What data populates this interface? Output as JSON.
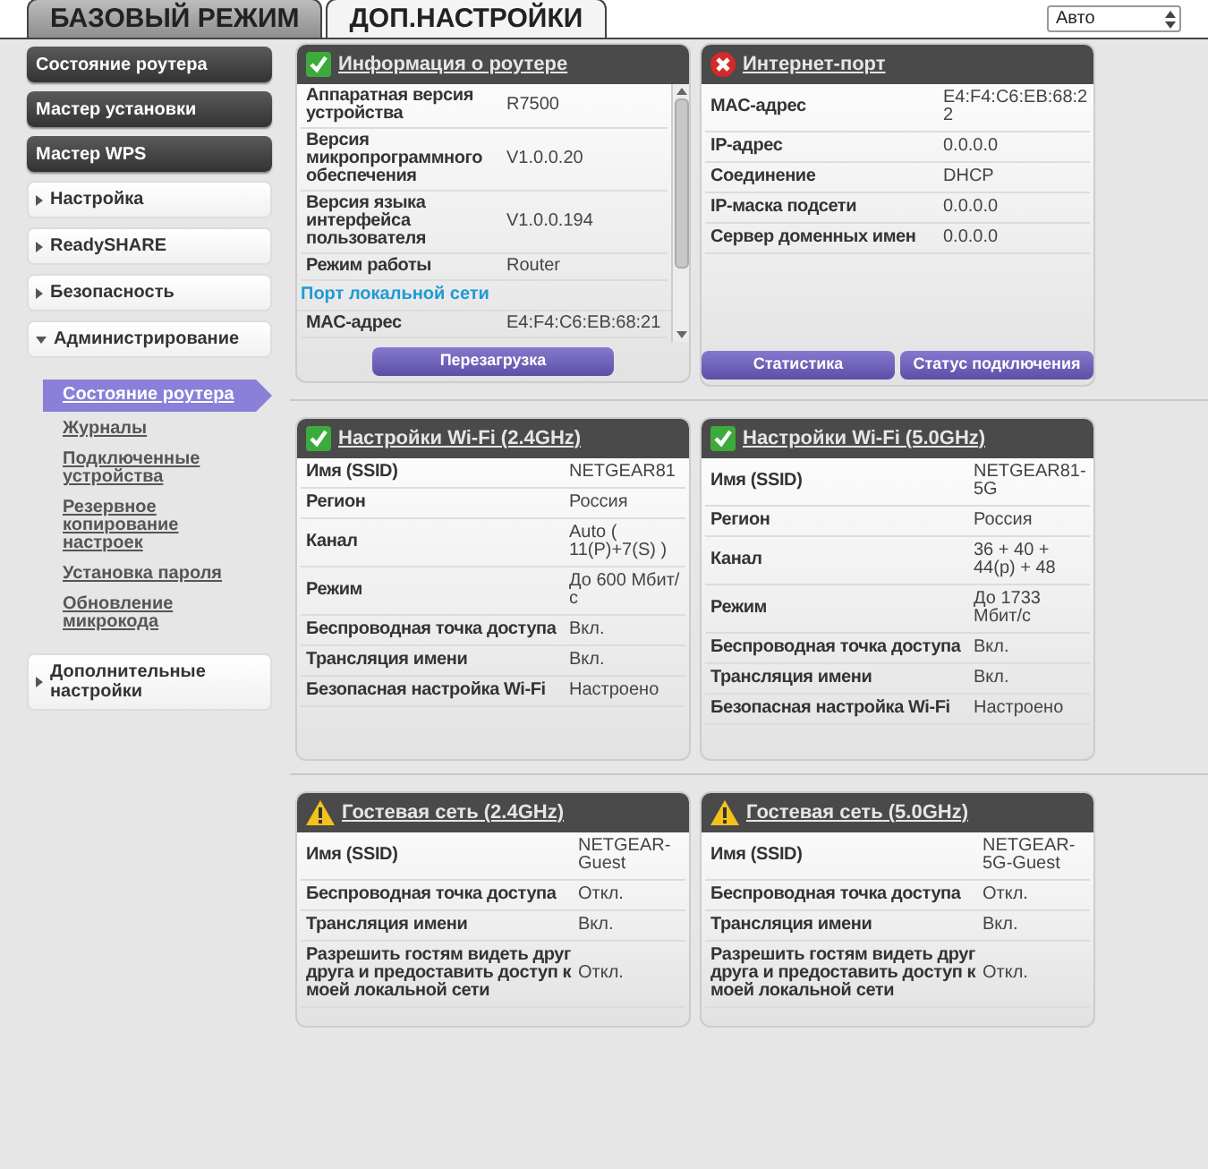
{
  "mode_tabs": [
    {
      "label": "БАЗОВЫЙ РЕЖИМ",
      "selected": false
    },
    {
      "label": "ДОП.НАСТРОЙКИ",
      "selected": true
    }
  ],
  "language_select": {
    "value": "Авто"
  },
  "sidebar": {
    "items": [
      {
        "kind": "button",
        "label": "Состояние роутера"
      },
      {
        "kind": "button",
        "label": "Мастер установки"
      },
      {
        "kind": "button",
        "label": "Мастер WPS"
      },
      {
        "kind": "section",
        "label": "Настройка",
        "expanded": false
      },
      {
        "kind": "section",
        "label": "ReadySHARE",
        "expanded": false
      },
      {
        "kind": "section",
        "label": "Безопасность",
        "expanded": false
      },
      {
        "kind": "section",
        "label": "Администрирование",
        "expanded": true,
        "children": [
          {
            "label": "Состояние роутера",
            "selected": true
          },
          {
            "label": "Журналы",
            "selected": false
          },
          {
            "label": "Подключенные устройства",
            "selected": false
          },
          {
            "label": "Резервное копирование настроек",
            "selected": false
          },
          {
            "label": "Установка пароля",
            "selected": false
          },
          {
            "label": "Обновление микрокода",
            "selected": false
          }
        ]
      },
      {
        "kind": "section",
        "label": "Дополнительные настройки",
        "expanded": false
      }
    ]
  },
  "panels": [
    {
      "title": "Информация о роутере",
      "kind": "ok",
      "scrollbar": true,
      "rows": [
        {
          "label": "Аппаратная версия устройства",
          "value": "R7500"
        },
        {
          "label": "Версия микропрограммного обеспечения",
          "value": "V1.0.0.20"
        },
        {
          "label": "Версия языка интерфейса пользователя",
          "value": "V1.0.0.194"
        },
        {
          "label": "Режим работы",
          "value": "Router"
        },
        {
          "kind": "section",
          "label": "Порт локальной сети"
        },
        {
          "label": "MAC-адрес",
          "value": "E4:F4:C6:EB:68:21"
        }
      ],
      "buttons": [
        "Перезагрузка"
      ]
    },
    {
      "title": "Интернет-порт",
      "kind": "error",
      "rows": [
        {
          "label": "MAC-адрес",
          "value": "E4:F4:C6:EB:68:22"
        },
        {
          "label": "IP-адрес",
          "value": "0.0.0.0"
        },
        {
          "label": "Соединение",
          "value": "DHCP"
        },
        {
          "label": "IP-маска подсети",
          "value": "0.0.0.0"
        },
        {
          "label": "Сервер доменных имен",
          "value": "0.0.0.0"
        }
      ],
      "buttons": [
        "Статистика",
        "Статус подключения"
      ]
    },
    {
      "title": "Настройки Wi-Fi (2.4GHz)",
      "kind": "ok",
      "rows": [
        {
          "label": "Имя (SSID)",
          "value": "NETGEAR81"
        },
        {
          "label": "Регион",
          "value": "Россия"
        },
        {
          "label": "Канал",
          "value": "Auto ( 11(P)+7(S) )"
        },
        {
          "label": "Режим",
          "value": "До 600 Мбит/с"
        },
        {
          "label": "Беспроводная точка доступа",
          "value": "Вкл."
        },
        {
          "label": "Трансляция имени",
          "value": "Вкл."
        },
        {
          "label": "Безопасная настройка Wi-Fi",
          "value": "Настроено"
        }
      ]
    },
    {
      "title": "Настройки Wi-Fi (5.0GHz)",
      "kind": "ok",
      "rows": [
        {
          "label": "Имя (SSID)",
          "value": "NETGEAR81-5G"
        },
        {
          "label": "Регион",
          "value": "Россия"
        },
        {
          "label": "Канал",
          "value": "36 + 40 + 44(p) + 48"
        },
        {
          "label": "Режим",
          "value": "До 1733 Мбит/с"
        },
        {
          "label": "Беспроводная точка доступа",
          "value": "Вкл."
        },
        {
          "label": "Трансляция имени",
          "value": "Вкл."
        },
        {
          "label": "Безопасная настройка Wi-Fi",
          "value": "Настроено"
        }
      ]
    },
    {
      "title": "Гостевая сеть (2.4GHz)",
      "kind": "warning",
      "rows": [
        {
          "label": "Имя (SSID)",
          "value": "NETGEAR-Guest"
        },
        {
          "label": "Беспроводная точка доступа",
          "value": "Откл."
        },
        {
          "label": "Трансляция имени",
          "value": "Вкл."
        },
        {
          "label": "Разрешить гостям видеть друг друга и предоставить доступ к моей локальной сети",
          "value": "Откл."
        }
      ]
    },
    {
      "title": "Гостевая сеть (5.0GHz)",
      "kind": "warning",
      "rows": [
        {
          "label": "Имя (SSID)",
          "value": "NETGEAR-5G-Guest"
        },
        {
          "label": "Беспроводная точка доступа",
          "value": "Откл."
        },
        {
          "label": "Трансляция имени",
          "value": "Вкл."
        },
        {
          "label": "Разрешить гостям видеть друг друга и предоставить доступ к моей локальной сети",
          "value": "Откл."
        }
      ]
    }
  ]
}
